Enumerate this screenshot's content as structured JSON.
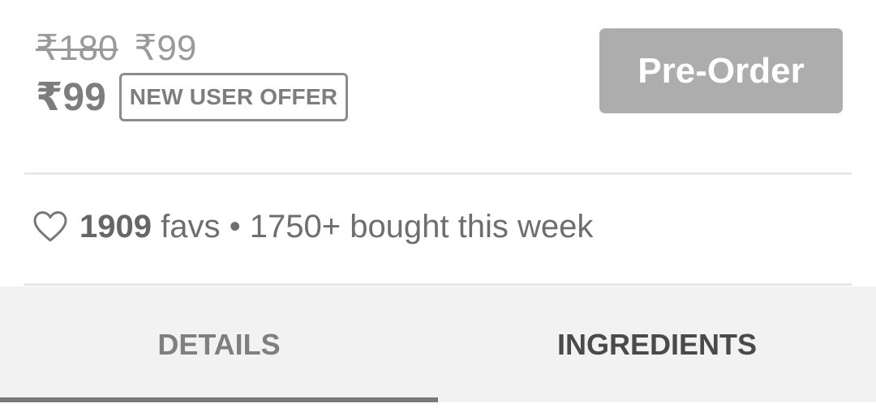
{
  "pricing": {
    "mrp": "₹180",
    "listed_price": "₹99",
    "final_price": "₹99",
    "offer_badge": "NEW USER OFFER"
  },
  "actions": {
    "preorder_label": "Pre-Order"
  },
  "stats": {
    "favs_count": "1909",
    "favs_label": "favs",
    "separator": "•",
    "bought_text": "1750+ bought this week"
  },
  "tabs": [
    {
      "label": "DETAILS",
      "active": true
    },
    {
      "label": "INGREDIENTS",
      "active": false
    }
  ],
  "colors": {
    "button_disabled": "#adadad",
    "tab_bar_bg": "#f2f2f2",
    "active_tab_indicator": "#7a7a7a"
  },
  "icons": {
    "favorite": "heart-outline-icon"
  }
}
